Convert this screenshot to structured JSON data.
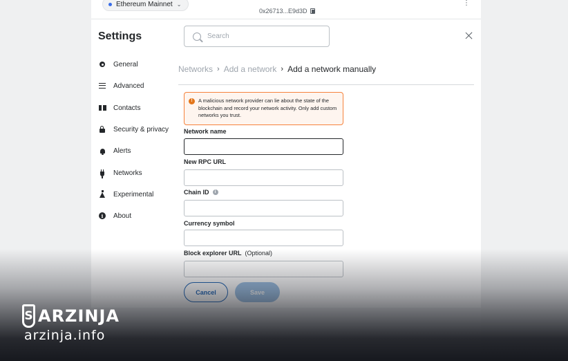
{
  "topbar": {
    "network": "Ethereum Mainnet",
    "account_address": "0x26713...E9d3D"
  },
  "settings": {
    "title": "Settings",
    "search_placeholder": "Search"
  },
  "sidebar": {
    "items": [
      {
        "label": "General",
        "icon": "gear-icon"
      },
      {
        "label": "Advanced",
        "icon": "sliders-icon"
      },
      {
        "label": "Contacts",
        "icon": "book-icon"
      },
      {
        "label": "Security & privacy",
        "icon": "lock-icon"
      },
      {
        "label": "Alerts",
        "icon": "bell-icon"
      },
      {
        "label": "Networks",
        "icon": "plug-icon"
      },
      {
        "label": "Experimental",
        "icon": "flask-icon"
      },
      {
        "label": "About",
        "icon": "info-icon"
      }
    ]
  },
  "breadcrumb": {
    "items": [
      "Networks",
      "Add a network",
      "Add a network manually"
    ]
  },
  "warning": {
    "text": "A malicious network provider can lie about the state of the blockchain and record your network activity. Only add custom networks you trust."
  },
  "form": {
    "network_name_label": "Network name",
    "rpc_url_label": "New RPC URL",
    "chain_id_label": "Chain ID",
    "currency_symbol_label": "Currency symbol",
    "block_explorer_label": "Block explorer URL",
    "block_explorer_optional": "(Optional)",
    "network_name_value": "",
    "rpc_url_value": "",
    "chain_id_value": "",
    "currency_symbol_value": "",
    "block_explorer_value": ""
  },
  "buttons": {
    "cancel": "Cancel",
    "save": "Save"
  },
  "watermark": {
    "brand": "ARZINJA",
    "url": "arzinja.info"
  },
  "colors": {
    "primary": "#1c62b3",
    "warning_border": "#f6823b",
    "warning_bg": "#fef5ef",
    "save_disabled": "#9cc0e4"
  }
}
